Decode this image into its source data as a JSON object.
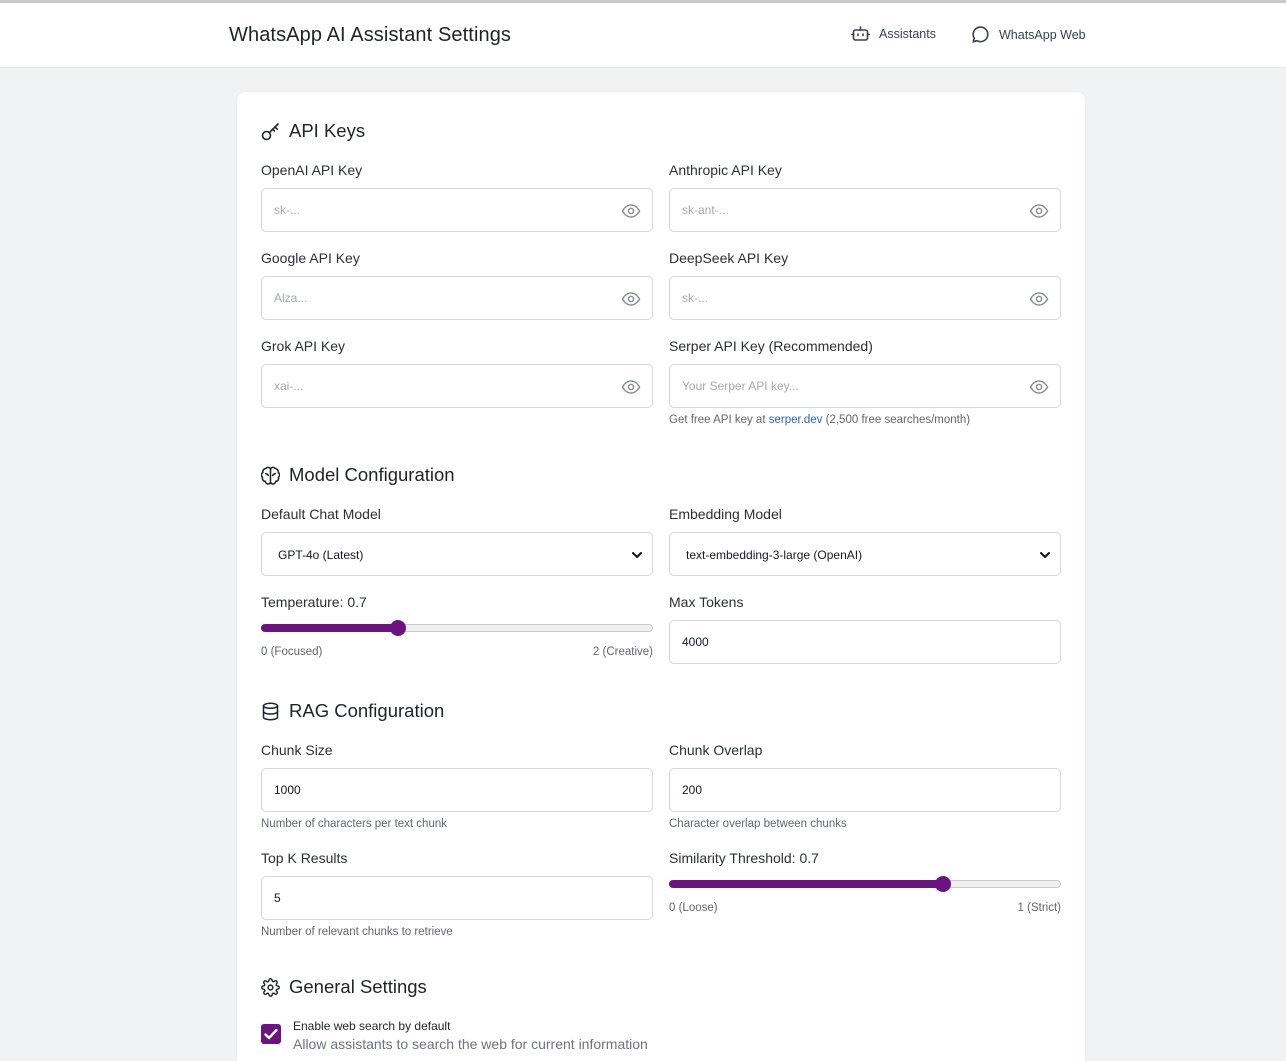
{
  "header": {
    "title": "WhatsApp AI Assistant Settings",
    "nav": {
      "assistants": "Assistants",
      "whatsapp_web": "WhatsApp Web"
    }
  },
  "api_keys": {
    "title": "API Keys",
    "fields": [
      {
        "label": "OpenAI API Key",
        "placeholder": "sk-..."
      },
      {
        "label": "Anthropic API Key",
        "placeholder": "sk-ant-..."
      },
      {
        "label": "Google API Key",
        "placeholder": "Alza..."
      },
      {
        "label": "DeepSeek API Key",
        "placeholder": "sk-..."
      },
      {
        "label": "Grok API Key",
        "placeholder": "xai-..."
      },
      {
        "label": "Serper API Key (Recommended)",
        "placeholder": "Your Serper API key..."
      }
    ],
    "serper_hint": {
      "prefix": "Get free API key at",
      "link": "serper.dev",
      "suffix": "(2,500 free searches/month)"
    }
  },
  "model_config": {
    "title": "Model Configuration",
    "chat_model": {
      "label": "Default Chat Model",
      "value": "GPT-4o (Latest)"
    },
    "embedding_model": {
      "label": "Embedding Model",
      "value": "text-embedding-3-large (OpenAI)"
    },
    "temperature": {
      "label": "Temperature: 0.7",
      "value": 0.7,
      "min": 0,
      "max": 2,
      "min_label": "0 (Focused)",
      "max_label": "2 (Creative)"
    },
    "max_tokens": {
      "label": "Max Tokens",
      "value": "4000"
    }
  },
  "rag_config": {
    "title": "RAG Configuration",
    "chunk_size": {
      "label": "Chunk Size",
      "value": "1000",
      "hint": "Number of characters per text chunk"
    },
    "chunk_overlap": {
      "label": "Chunk Overlap",
      "value": "200",
      "hint": "Character overlap between chunks"
    },
    "top_k": {
      "label": "Top K Results",
      "value": "5",
      "hint": "Number of relevant chunks to retrieve"
    },
    "similarity": {
      "label": "Similarity Threshold: 0.7",
      "value": 0.7,
      "min": 0,
      "max": 1,
      "min_label": "0 (Loose)",
      "max_label": "1 (Strict)"
    }
  },
  "general": {
    "title": "General Settings",
    "web_search": {
      "label": "Enable web search by default",
      "description": "Allow assistants to search the web for current information",
      "checked": true
    }
  },
  "colors": {
    "accent": "#6b1480",
    "link": "#2b5fc7"
  }
}
